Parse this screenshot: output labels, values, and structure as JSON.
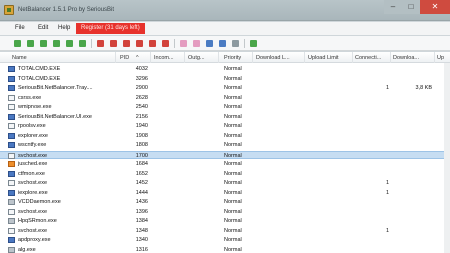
{
  "window": {
    "title": "NetBalancer 1.5.1 Pro by SeriousBit"
  },
  "menu": {
    "items": [
      "File",
      "Edit",
      "Help"
    ],
    "register": "Register (31 days left)"
  },
  "columns": [
    "Name",
    "PID",
    "Incom...",
    "Outg...",
    "Priority",
    "Download L...",
    "Upload Limit",
    "Connecti...",
    "Downloa...",
    "Up"
  ],
  "pid_sort_indicator": "^",
  "rows": [
    {
      "name": "TOTALCMD.EXE",
      "pid": "4032",
      "priority": "Normal",
      "icon": "ic-blue"
    },
    {
      "name": "TOTALCMD.EXE",
      "pid": "3296",
      "priority": "Normal",
      "icon": "ic-blue"
    },
    {
      "name": "SeriousBit.NetBalancer.Tray....",
      "pid": "2900",
      "priority": "Normal",
      "connections": "1",
      "download": "3,8 KB",
      "icon": "ic-blue"
    },
    {
      "name": "csrss.exe",
      "pid": "2628",
      "priority": "Normal",
      "icon": "ic-doc"
    },
    {
      "name": "wmiprvse.exe",
      "pid": "2540",
      "priority": "Normal",
      "icon": "ic-doc"
    },
    {
      "name": "SeriousBit.NetBalancer.UI.exe",
      "pid": "2156",
      "priority": "Normal",
      "icon": "ic-blue"
    },
    {
      "name": "rpoolsv.exe",
      "pid": "1940",
      "priority": "Normal",
      "icon": "ic-doc"
    },
    {
      "name": "explorer.exe",
      "pid": "1908",
      "priority": "Normal",
      "icon": "ic-blue"
    },
    {
      "name": "wscntfy.exe",
      "pid": "1808",
      "priority": "Normal",
      "icon": "ic-blue"
    },
    {
      "name": "svchost.exe",
      "pid": "1700",
      "priority": "Normal",
      "icon": "ic-doc",
      "selected": true
    },
    {
      "name": "jusched.exe",
      "pid": "1684",
      "priority": "Normal",
      "icon": "ic-orange"
    },
    {
      "name": "ctfmon.exe",
      "pid": "1652",
      "priority": "Normal",
      "icon": "ic-blue"
    },
    {
      "name": "svchost.exe",
      "pid": "1452",
      "priority": "Normal",
      "connections": "1",
      "icon": "ic-doc"
    },
    {
      "name": "iexplore.exe",
      "pid": "1444",
      "priority": "Normal",
      "connections": "1",
      "icon": "ic-blue"
    },
    {
      "name": "VCDDaemon.exe",
      "pid": "1436",
      "priority": "Normal",
      "icon": "ic-grey"
    },
    {
      "name": "svchost.exe",
      "pid": "1396",
      "priority": "Normal",
      "icon": "ic-doc"
    },
    {
      "name": "HpqSRmon.exe",
      "pid": "1384",
      "priority": "Normal",
      "icon": "ic-grey"
    },
    {
      "name": "svchost.exe",
      "pid": "1348",
      "priority": "Normal",
      "connections": "1",
      "icon": "ic-doc"
    },
    {
      "name": "apdproxy.exe",
      "pid": "1340",
      "priority": "Normal",
      "icon": "ic-blue"
    },
    {
      "name": "alg.exe",
      "pid": "1316",
      "priority": "Normal",
      "icon": "ic-grey"
    }
  ]
}
